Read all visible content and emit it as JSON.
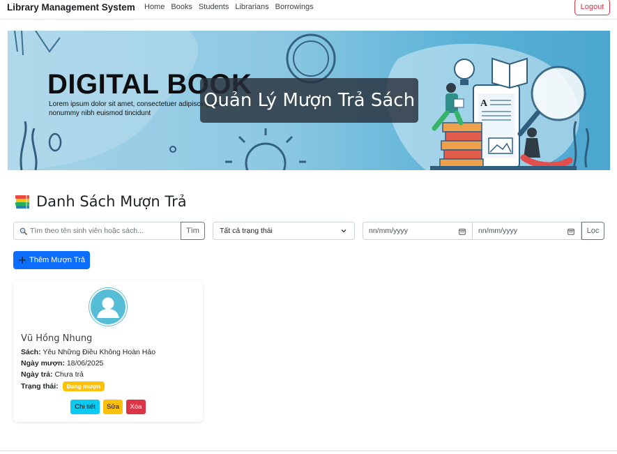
{
  "navbar": {
    "brand": "Library Management System",
    "links": [
      "Home",
      "Books",
      "Students",
      "Librarians",
      "Borrowings"
    ],
    "logout_label": "Logout"
  },
  "banner": {
    "title": "DIGITAL BOOK",
    "subtitle": "Lorem ipsum dolor sit amet, consectetuer adipiscing diam nonummy nibh euismod tincidunt",
    "overlay_title": "Quản Lý Mượn Trả Sách"
  },
  "section": {
    "title": "Danh Sách Mượn Trả",
    "icon": "books-icon"
  },
  "filters": {
    "search_placeholder": "Tìm theo tên sinh viên hoặc sách...",
    "search_button": "Tìm",
    "status_selected": "Tất cả trạng thái",
    "date_from_placeholder": "nn/mm/yyyy",
    "date_to_placeholder": "nn/mm/yyyy",
    "filter_button": "Lọc"
  },
  "add_button": {
    "label": "Thêm Mượn Trả",
    "color": "#0d6efd"
  },
  "borrowings": [
    {
      "student_name": "Vũ Hồng Nhung",
      "book_label": "Sách:",
      "book": "Yêu Những Điều Không Hoàn Hảo",
      "borrow_date_label": "Ngày mượn:",
      "borrow_date": "18/06/2025",
      "return_date_label": "Ngày trả:",
      "return_date": "Chưa trả",
      "status_label": "Trạng thái:",
      "status": "Đang mượn",
      "status_color": "#ffc107",
      "actions": {
        "detail": "Chi tiết",
        "edit": "Sửa",
        "delete": "Xóa"
      }
    }
  ]
}
